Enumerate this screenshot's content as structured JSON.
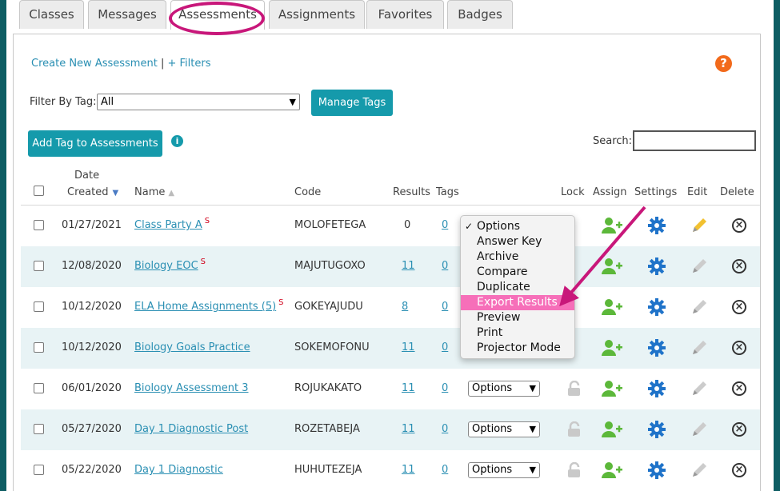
{
  "tabs": [
    "Classes",
    "Messages",
    "Assessments",
    "Assignments",
    "Favorites",
    "Badges"
  ],
  "active_tab": "Assessments",
  "toolbar": {
    "create_link": "Create New Assessment",
    "separator": "|",
    "filters_link": "+ Filters",
    "help_icon": "?",
    "filter_label": "Filter By Tag:",
    "filter_value": "All",
    "manage_tags": "Manage Tags",
    "add_tag": "Add Tag to Assessments",
    "info_icon": "i",
    "search_label": "Search:",
    "search_value": ""
  },
  "headers": {
    "date_line1": "Date",
    "date_line2": "Created",
    "name": "Name",
    "code": "Code",
    "results": "Results",
    "tags": "Tags",
    "lock": "Lock",
    "assign": "Assign",
    "settings": "Settings",
    "edit": "Edit",
    "delete": "Delete"
  },
  "rows": [
    {
      "date": "01/27/2021",
      "name": "Class Party A",
      "shared": "S",
      "code": "MOLOFETEGA",
      "results": "0",
      "results_link": false,
      "tags": "0",
      "options": "Options"
    },
    {
      "date": "12/08/2020",
      "name": "Biology EOC",
      "shared": "S",
      "code": "MAJUTUGOXO",
      "results": "11",
      "results_link": true,
      "tags": "0",
      "options": "Options"
    },
    {
      "date": "10/12/2020",
      "name": "ELA Home Assignments (5)",
      "shared": "S",
      "code": "GOKEYAJUDU",
      "results": "8",
      "results_link": true,
      "tags": "0",
      "options": "Options"
    },
    {
      "date": "10/12/2020",
      "name": "Biology Goals Practice",
      "shared": "",
      "code": "SOKEMOFONU",
      "results": "11",
      "results_link": true,
      "tags": "0",
      "options": "Options"
    },
    {
      "date": "06/01/2020",
      "name": "Biology Assessment 3",
      "shared": "",
      "code": "ROJUKAKATO",
      "results": "11",
      "results_link": true,
      "tags": "0",
      "options": "Options"
    },
    {
      "date": "05/27/2020",
      "name": "Day 1 Diagnostic Post",
      "shared": "",
      "code": "ROZETABEJA",
      "results": "11",
      "results_link": true,
      "tags": "0",
      "options": "Options"
    },
    {
      "date": "05/22/2020",
      "name": "Day 1 Diagnostic",
      "shared": "",
      "code": "HUHUTEZEJA",
      "results": "11",
      "results_link": true,
      "tags": "0",
      "options": "Options"
    }
  ],
  "dropdown_menu": {
    "check_mark": "✓",
    "items": [
      "Options",
      "Answer Key",
      "Archive",
      "Compare",
      "Duplicate",
      "Export Results",
      "Preview",
      "Print",
      "Projector Mode"
    ],
    "selected": "Options",
    "highlighted": "Export Results"
  },
  "icons": {
    "lock": "lock-icon",
    "assign": "assign-user-plus-icon",
    "settings": "gear-icon",
    "edit": "pencil-icon",
    "delete": "circle-x-icon",
    "delete_glyph": "×"
  },
  "colors": {
    "accent": "#159aab",
    "link": "#2a8fb3",
    "annotation": "#c8177a",
    "highlight": "#f66fb9",
    "assign_green": "#5cb83a",
    "settings_blue": "#1f73c9",
    "edit_active": "#f2c130",
    "help_orange": "#f26a1b"
  }
}
